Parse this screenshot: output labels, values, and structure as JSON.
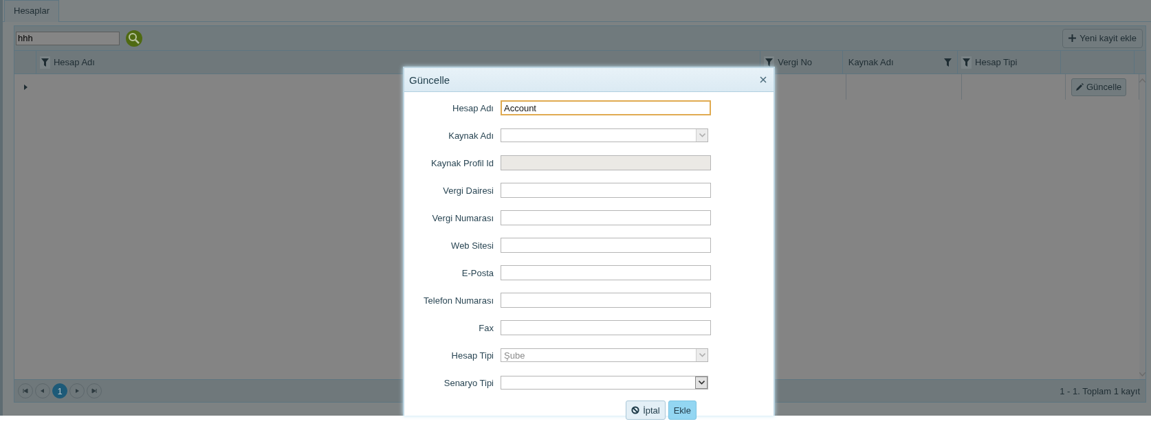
{
  "tabs": [
    {
      "label": "Hesaplar",
      "selected": true
    }
  ],
  "search": {
    "value": "hhh"
  },
  "add_button": {
    "label": "Yeni kayit ekle"
  },
  "table": {
    "columns": [
      {
        "label": "Hesap Adı",
        "filter_after_label": false
      },
      {
        "label": "Vergi No",
        "filter_after_label": false
      },
      {
        "label": "Kaynak Adı",
        "filter_after_label": true
      },
      {
        "label": "Hesap Tipi",
        "filter_after_label": false
      }
    ],
    "rows": [
      {
        "expanded": false,
        "action": "Güncelle"
      }
    ]
  },
  "pager": {
    "pages": [
      {
        "label": "1",
        "selected": true
      }
    ],
    "summary": "1 - 1. Toplam 1 kayıt"
  },
  "dialog": {
    "title": "Güncelle",
    "fields": [
      {
        "label": "Hesap Adı",
        "kind": "text",
        "value": "Account",
        "disabled": false,
        "focused": true
      },
      {
        "label": "Kaynak Adı",
        "kind": "select",
        "disabled": true,
        "focused": false
      },
      {
        "label": "Kaynak Profil Id",
        "kind": "text",
        "disabled": true,
        "focused": false
      },
      {
        "label": "Vergi Dairesi",
        "kind": "text",
        "disabled": false,
        "focused": false
      },
      {
        "label": "Vergi Numarası",
        "kind": "text",
        "disabled": false,
        "focused": false
      },
      {
        "label": "Web Sitesi",
        "kind": "text",
        "disabled": false,
        "focused": false
      },
      {
        "label": "E-Posta",
        "kind": "text",
        "disabled": false,
        "focused": false
      },
      {
        "label": "Telefon Numarası",
        "kind": "text",
        "disabled": false,
        "focused": false
      },
      {
        "label": "Fax",
        "kind": "text",
        "disabled": false,
        "focused": false
      },
      {
        "label": "Hesap Tipi",
        "kind": "select",
        "value": "Şube",
        "disabled": true,
        "focused": false
      },
      {
        "label": "Senaryo Tipi",
        "kind": "select",
        "disabled": false,
        "focused": false
      }
    ],
    "buttons": [
      {
        "label": "İptal",
        "kind": "cancel"
      },
      {
        "label": "Ekle",
        "kind": "primary"
      }
    ]
  }
}
